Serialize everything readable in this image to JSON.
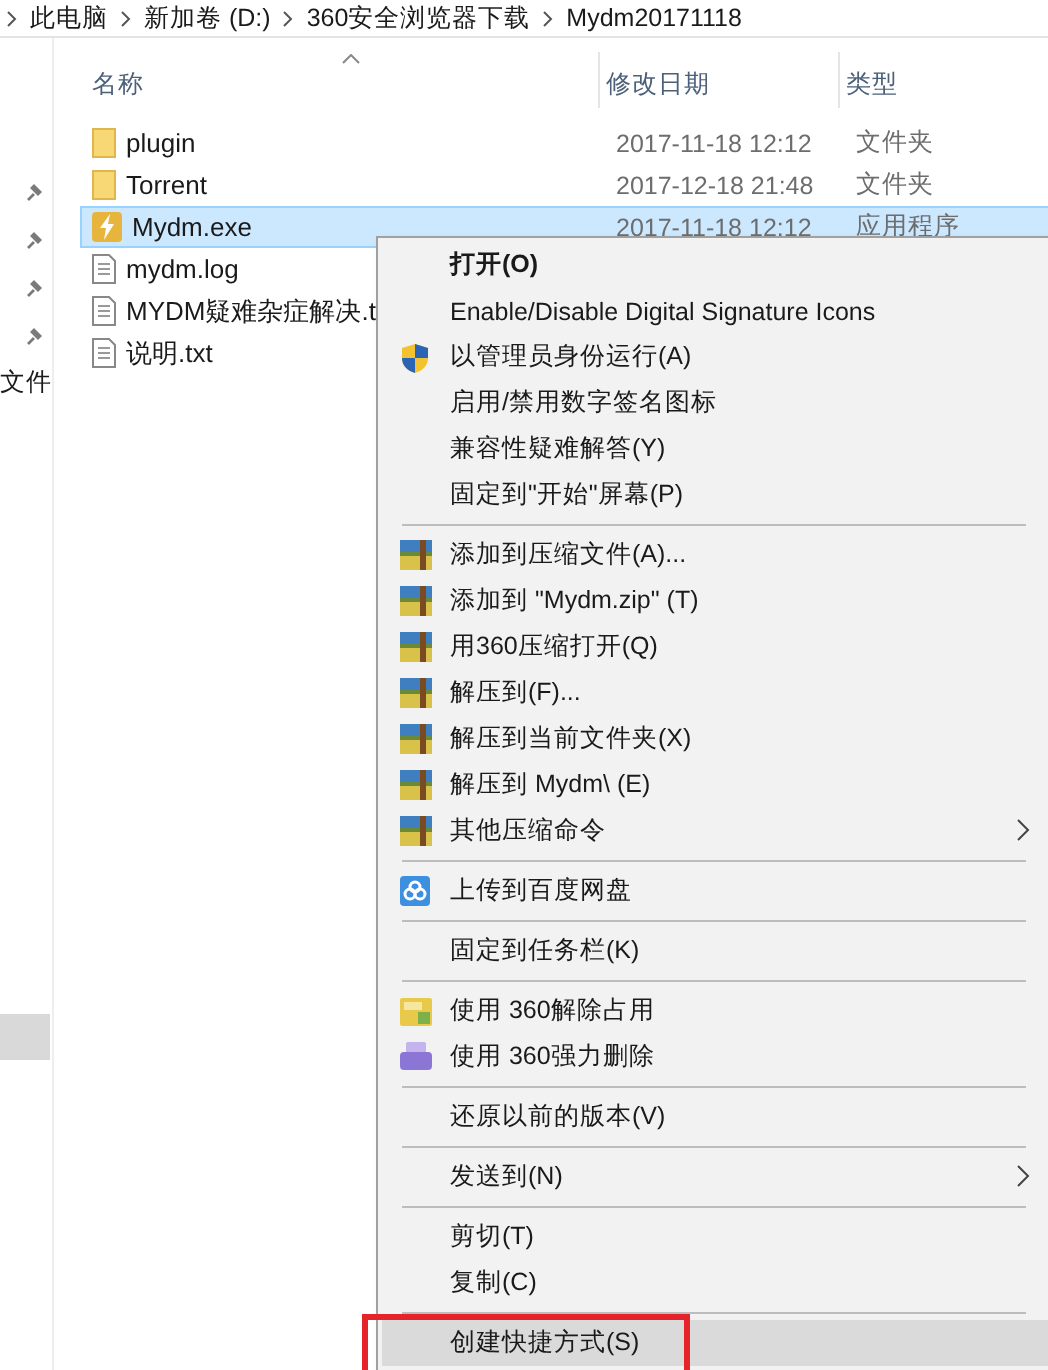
{
  "breadcrumb": [
    "此电脑",
    "新加卷 (D:)",
    "360安全浏览器下载",
    "Mydm20171118"
  ],
  "nav_pane": {
    "pinned_count_label": "文件"
  },
  "columns": [
    {
      "label": "名称",
      "sorted": true
    },
    {
      "label": "修改日期",
      "sorted": false
    },
    {
      "label": "类型",
      "sorted": false
    }
  ],
  "files": [
    {
      "kind": "folder",
      "name": "plugin",
      "date": "2017-11-18 12:12",
      "type": "文件夹",
      "selected": false
    },
    {
      "kind": "folder",
      "name": "Torrent",
      "date": "2017-12-18 21:48",
      "type": "文件夹",
      "selected": false
    },
    {
      "kind": "app",
      "name": "Mydm.exe",
      "date": "2017-11-18 12:12",
      "type": "应用程序",
      "selected": true
    },
    {
      "kind": "text",
      "name": "mydm.log",
      "selected": false
    },
    {
      "kind": "text",
      "name": "MYDM疑难杂症解决.t",
      "selected": false
    },
    {
      "kind": "text",
      "name": "说明.txt",
      "selected": false
    }
  ],
  "context_menu": [
    {
      "kind": "plain",
      "label": "打开(O)",
      "bold": true,
      "submenu": false,
      "selected": false,
      "outlined": false
    },
    {
      "kind": "plain",
      "label": "Enable/Disable Digital Signature Icons",
      "bold": false,
      "submenu": false,
      "selected": false,
      "outlined": false
    },
    {
      "kind": "shield",
      "label": "以管理员身份运行(A)",
      "bold": false,
      "submenu": false,
      "selected": false,
      "outlined": false
    },
    {
      "kind": "plain",
      "label": "启用/禁用数字签名图标",
      "bold": false,
      "submenu": false,
      "selected": false,
      "outlined": false
    },
    {
      "kind": "plain",
      "label": "兼容性疑难解答(Y)",
      "bold": false,
      "submenu": false,
      "selected": false,
      "outlined": false
    },
    {
      "kind": "plain",
      "label": "固定到\"开始\"屏幕(P)",
      "bold": false,
      "submenu": false,
      "selected": false,
      "outlined": false
    },
    {
      "kind": "separator"
    },
    {
      "kind": "archive",
      "label": "添加到压缩文件(A)...",
      "bold": false,
      "submenu": false,
      "selected": false,
      "outlined": false
    },
    {
      "kind": "archive",
      "label": "添加到 \"Mydm.zip\" (T)",
      "bold": false,
      "submenu": false,
      "selected": false,
      "outlined": false
    },
    {
      "kind": "archive",
      "label": "用360压缩打开(Q)",
      "bold": false,
      "submenu": false,
      "selected": false,
      "outlined": false
    },
    {
      "kind": "archive",
      "label": "解压到(F)...",
      "bold": false,
      "submenu": false,
      "selected": false,
      "outlined": false
    },
    {
      "kind": "archive",
      "label": "解压到当前文件夹(X)",
      "bold": false,
      "submenu": false,
      "selected": false,
      "outlined": false
    },
    {
      "kind": "archive",
      "label": "解压到 Mydm\\ (E)",
      "bold": false,
      "submenu": false,
      "selected": false,
      "outlined": false
    },
    {
      "kind": "archive",
      "label": "其他压缩命令",
      "bold": false,
      "submenu": true,
      "selected": false,
      "outlined": false
    },
    {
      "kind": "separator"
    },
    {
      "kind": "cloud",
      "label": "上传到百度网盘",
      "bold": false,
      "submenu": false,
      "selected": false,
      "outlined": false
    },
    {
      "kind": "separator"
    },
    {
      "kind": "plain",
      "label": "固定到任务栏(K)",
      "bold": false,
      "submenu": false,
      "selected": false,
      "outlined": false
    },
    {
      "kind": "separator"
    },
    {
      "kind": "unlock",
      "label": "使用 360解除占用",
      "bold": false,
      "submenu": false,
      "selected": false,
      "outlined": false
    },
    {
      "kind": "shred",
      "label": "使用 360强力删除",
      "bold": false,
      "submenu": false,
      "selected": false,
      "outlined": false
    },
    {
      "kind": "separator"
    },
    {
      "kind": "plain",
      "label": "还原以前的版本(V)",
      "bold": false,
      "submenu": false,
      "selected": false,
      "outlined": false
    },
    {
      "kind": "separator"
    },
    {
      "kind": "plain",
      "label": "发送到(N)",
      "bold": false,
      "submenu": true,
      "selected": false,
      "outlined": false
    },
    {
      "kind": "separator"
    },
    {
      "kind": "plain",
      "label": "剪切(T)",
      "bold": false,
      "submenu": false,
      "selected": false,
      "outlined": false
    },
    {
      "kind": "plain",
      "label": "复制(C)",
      "bold": false,
      "submenu": false,
      "selected": false,
      "outlined": false
    },
    {
      "kind": "separator"
    },
    {
      "kind": "plain",
      "label": "创建快捷方式(S)",
      "bold": false,
      "submenu": false,
      "selected": true,
      "outlined": true
    }
  ]
}
